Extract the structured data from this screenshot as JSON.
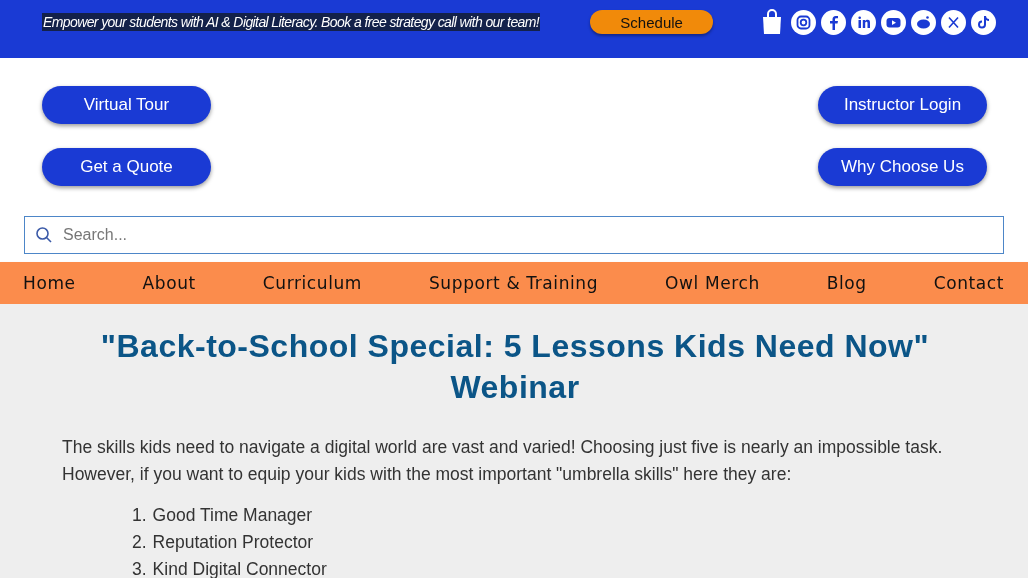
{
  "promo_bar": {
    "message": "Empower your students with AI & Digital Literacy. Book a free strategy call with our team!",
    "button": "Schedule"
  },
  "action_buttons": {
    "left": [
      "Virtual Tour",
      "Get a Quote"
    ],
    "right": [
      "Instructor Login",
      "Why Choose Us"
    ]
  },
  "search": {
    "placeholder": "Search..."
  },
  "nav": [
    {
      "label": "Home"
    },
    {
      "label": "About"
    },
    {
      "label": "Curriculum"
    },
    {
      "label": "Support & Training"
    },
    {
      "label": "Owl Merch"
    },
    {
      "label": "Blog"
    },
    {
      "label": "Contact"
    }
  ],
  "article": {
    "title": "\"Back-to-School Special: 5 Lessons Kids Need Now\" Webinar",
    "intro": "The skills kids need to navigate a digital world are vast and varied! Choosing just five is nearly an impossible task. However, if you want to equip your kids with the most important \"umbrella skills\" here they are:",
    "list": [
      {
        "number": "1.",
        "text": "Good Time Manager"
      },
      {
        "number": "2.",
        "text": "Reputation Protector"
      },
      {
        "number": "3.",
        "text": "Kind Digital Connector"
      }
    ]
  }
}
